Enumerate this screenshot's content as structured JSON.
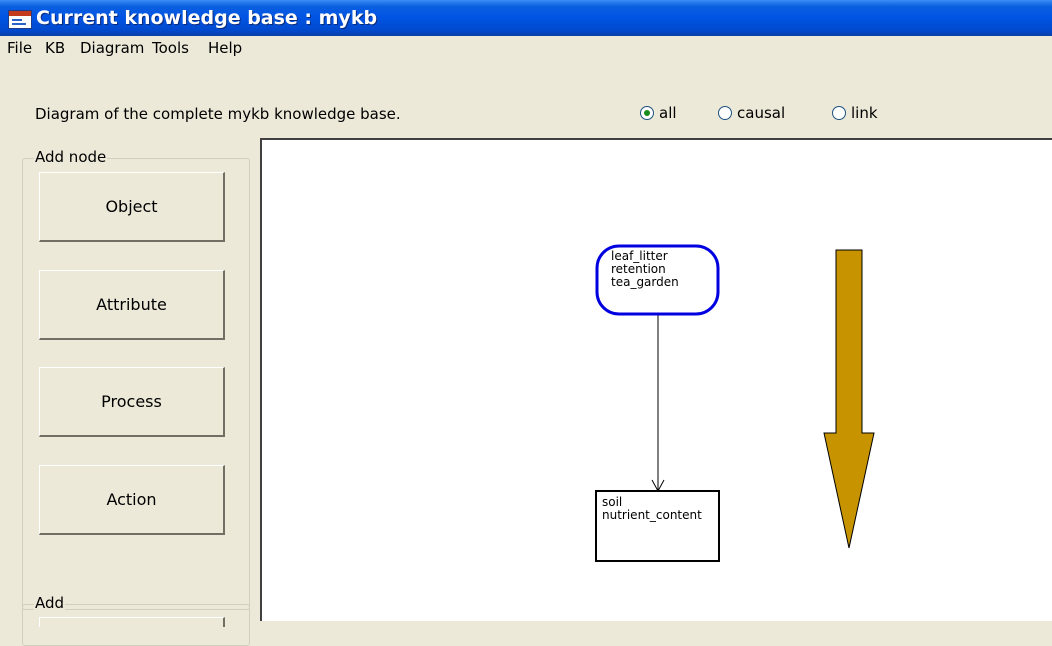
{
  "window": {
    "title": "Current knowledge base : mykb"
  },
  "menu": {
    "items": [
      "File",
      "KB",
      "Diagram",
      "Tools",
      "Help"
    ]
  },
  "info": {
    "text": "Diagram of the complete mykb knowledge base.",
    "filter_options": [
      {
        "label": "all",
        "selected": true
      },
      {
        "label": "causal",
        "selected": false
      },
      {
        "label": "link",
        "selected": false
      }
    ]
  },
  "add_node": {
    "title": "Add node",
    "buttons": [
      "Object",
      "Attribute",
      "Process",
      "Action"
    ]
  },
  "add_group": {
    "title": "Add"
  },
  "diagram": {
    "source_node": {
      "lines": [
        "leaf_litter",
        "retention",
        "tea_garden"
      ],
      "shape": "rounded",
      "border_color": "#0000e0"
    },
    "target_node": {
      "lines": [
        "soil",
        "nutrient_content"
      ],
      "shape": "rectangle",
      "border_color": "#000000"
    },
    "arrow_color": "#c79400"
  }
}
